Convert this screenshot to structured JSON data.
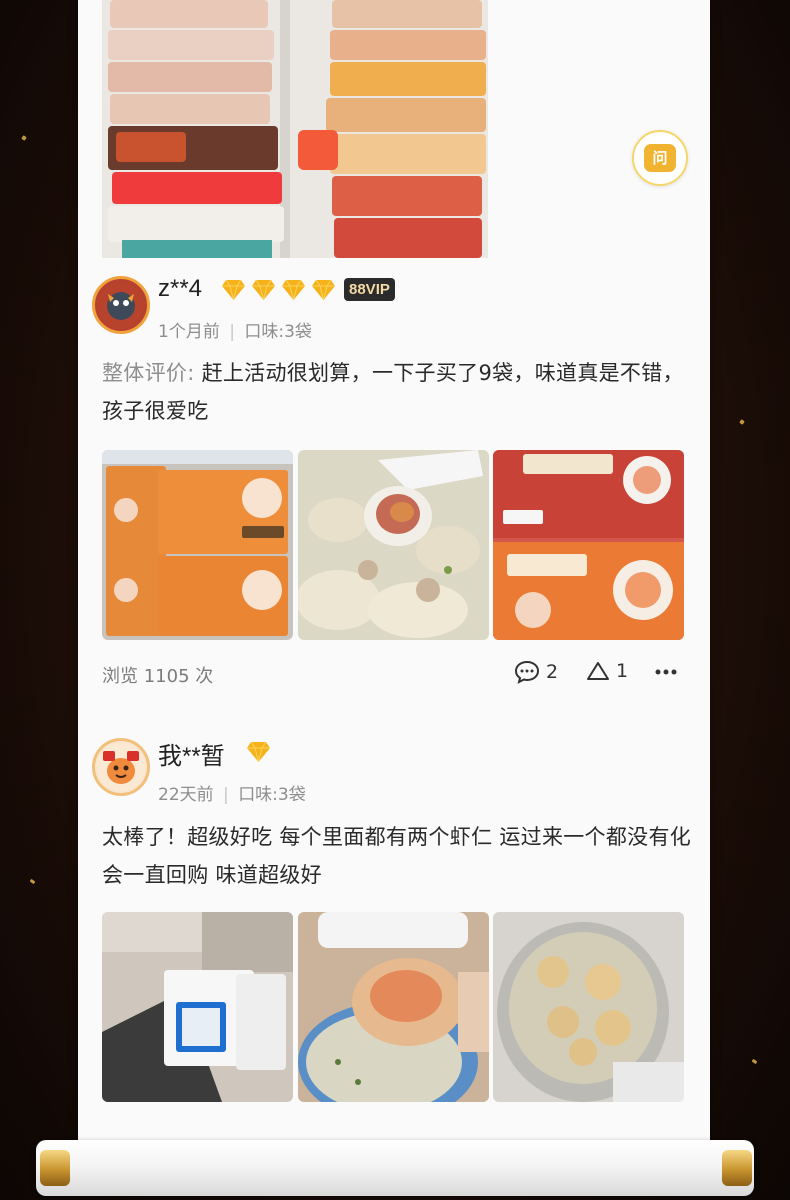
{
  "ask_button": {
    "label": "问"
  },
  "reviews": [
    {
      "username": "z**4",
      "vip_label": "88VIP",
      "diamond_count": 4,
      "time": "1个月前",
      "spec": "口味:3袋",
      "text_label": "整体评价:",
      "text": "赶上活动很划算，一下子买了9袋，味道真是不错，孩子很爱吃",
      "views_label": "浏览 1105 次",
      "comment_count": "2",
      "like_count": "1"
    },
    {
      "username": "我**暂",
      "diamond_count": 1,
      "time": "22天前",
      "spec": "口味:3袋",
      "text": "太棒了！超级好吃 每个里面都有两个虾仁 运过来一个都没有化 会一直回购 味道超级好"
    }
  ],
  "colors": {
    "accent_gold": "#f0b430",
    "diamond": "#f5b21b",
    "vip_bg": "#2b2b2b",
    "background": "#1e0e08"
  },
  "icons": [
    "comment-icon",
    "like-icon",
    "more-icon",
    "diamond-icon",
    "question-icon"
  ]
}
